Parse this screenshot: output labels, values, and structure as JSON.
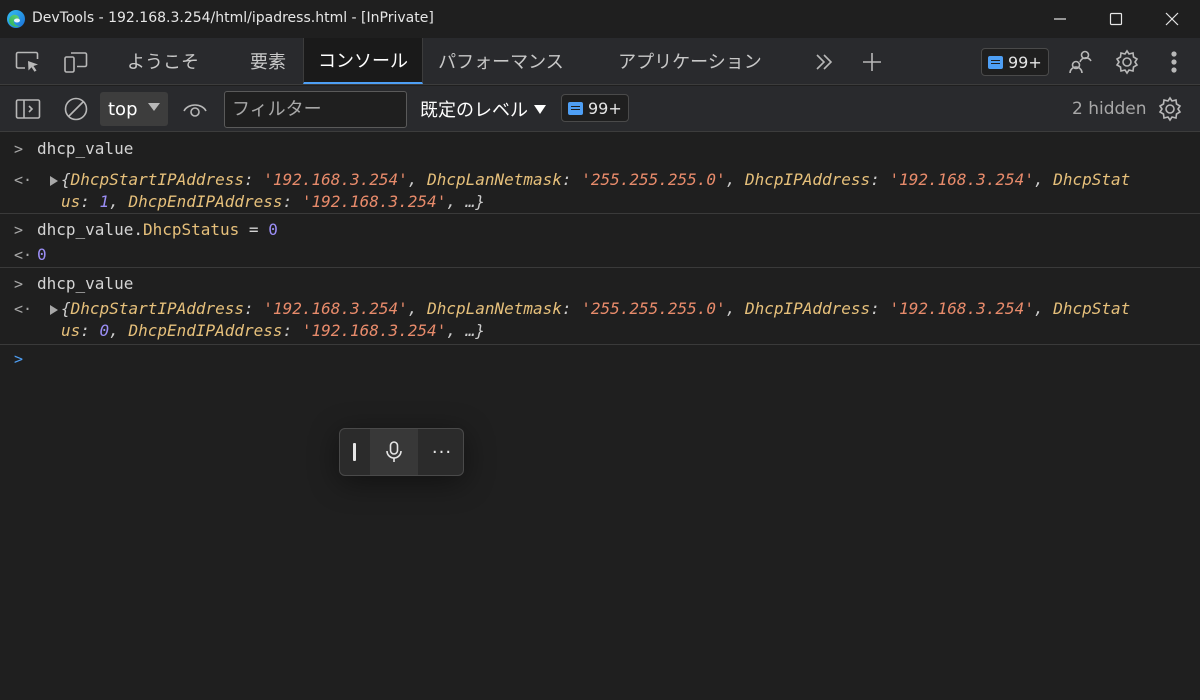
{
  "window": {
    "title": "DevTools - 192.168.3.254/html/ipadress.html - [InPrivate]"
  },
  "tabs": [
    {
      "label": "ようこそ"
    },
    {
      "label": "要素"
    },
    {
      "label": "コンソール",
      "active": true
    },
    {
      "label": "パフォーマンス"
    },
    {
      "label": "アプリケーション"
    }
  ],
  "toolbar": {
    "issues_count": "99+"
  },
  "console_toolbar": {
    "context": "top",
    "filter_placeholder": "フィルター",
    "levels_label": "既定のレベル",
    "issues_count": "99+",
    "hidden_label": "2 hidden"
  },
  "console": {
    "entries": [
      {
        "type": "input",
        "text": "dhcp_value"
      },
      {
        "type": "output-object",
        "line1": {
          "k1": "DhcpStartIPAddress",
          "v1": "'192.168.3.254'",
          "k2": "DhcpLanNetmask",
          "v2": "'255.255.255.0'",
          "k3": "DhcpIPAddress",
          "v3": "'192.168.3.254'",
          "k4a": "DhcpStat"
        },
        "line2": {
          "k4b": "us",
          "v4": "1",
          "k5": "DhcpEndIPAddress",
          "v5": "'192.168.3.254'",
          "ellipsis": "…"
        }
      },
      {
        "type": "input",
        "obj": "dhcp_value",
        "prop": "DhcpStatus",
        "rest": " = ",
        "val": "0"
      },
      {
        "type": "output-value",
        "text": "0"
      },
      {
        "type": "input",
        "text": "dhcp_value"
      },
      {
        "type": "output-object",
        "line1": {
          "k1": "DhcpStartIPAddress",
          "v1": "'192.168.3.254'",
          "k2": "DhcpLanNetmask",
          "v2": "'255.255.255.0'",
          "k3": "DhcpIPAddress",
          "v3": "'192.168.3.254'",
          "k4a": "DhcpStat"
        },
        "line2": {
          "k4b": "us",
          "v4": "0",
          "k5": "DhcpEndIPAddress",
          "v5": "'192.168.3.254'",
          "ellipsis": "…"
        }
      }
    ]
  },
  "voice_toolbar": {
    "more_label": "···"
  },
  "colors": {
    "accent": "#4e9ff5",
    "key": "#e6c07b",
    "string": "#e88b6b",
    "number": "#9b8ef6"
  }
}
